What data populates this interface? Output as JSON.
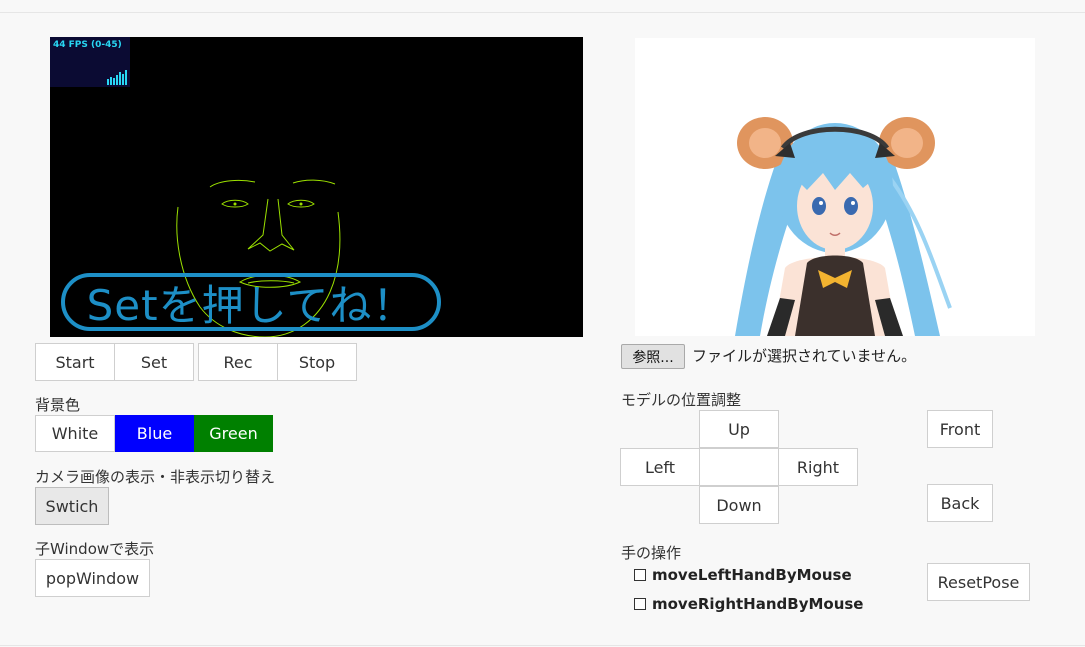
{
  "camera": {
    "fps_label": "44 FPS (0-45)",
    "overlay_message": "Setを押してね！"
  },
  "controls": {
    "start": "Start",
    "set": "Set",
    "rec": "Rec",
    "stop": "Stop"
  },
  "background": {
    "label": "背景色",
    "white": "White",
    "blue": "Blue",
    "green": "Green"
  },
  "camera_toggle": {
    "label": "カメラ画像の表示・非表示切り替え",
    "button": "Swtich"
  },
  "child_window": {
    "label": "子Windowで表示",
    "button": "popWindow"
  },
  "file_input": {
    "button": "参照...",
    "status": "ファイルが選択されていません。"
  },
  "position": {
    "label": "モデルの位置調整",
    "up": "Up",
    "left": "Left",
    "right": "Right",
    "down": "Down",
    "front": "Front",
    "back": "Back"
  },
  "hands": {
    "label": "手の操作",
    "left": "moveLeftHandByMouse",
    "right": "moveRightHandByMouse",
    "reset": "ResetPose"
  },
  "colors": {
    "accent_blue": "#1d8fc6",
    "fps_cyan": "#28d7f4",
    "face_green": "#9be000",
    "bg_blue": "#0000ff",
    "bg_green": "#008000"
  }
}
